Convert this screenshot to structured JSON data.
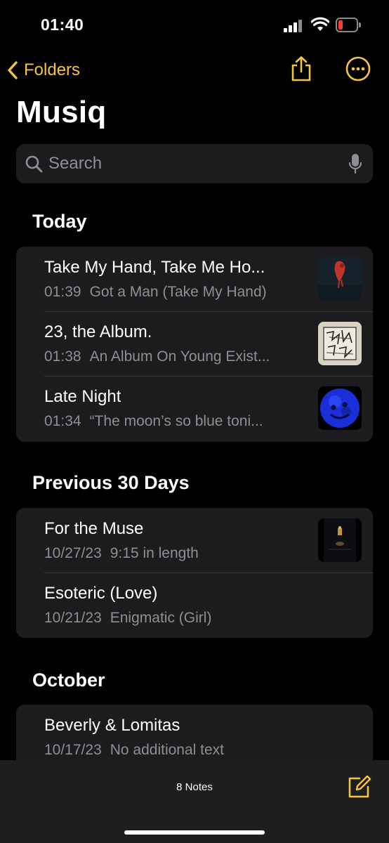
{
  "status": {
    "time": "01:40"
  },
  "nav": {
    "back_label": "Folders"
  },
  "title": "Musiq",
  "search": {
    "placeholder": "Search"
  },
  "sections": [
    {
      "title": "Today",
      "notes": [
        {
          "title": "Take My Hand, Take Me Ho...",
          "date": "01:39",
          "preview": "Got a Man (Take My Hand)",
          "thumbnail": "red-figure-artwork"
        },
        {
          "title": "23, the Album.",
          "date": "01:38",
          "preview": "An Album On Young Exist...",
          "thumbnail": "sketch-artwork"
        },
        {
          "title": "Late Night",
          "date": "01:34",
          "preview": "“The moon’s so blue toni...",
          "thumbnail": "blue-moon-artwork"
        }
      ]
    },
    {
      "title": "Previous 30 Days",
      "notes": [
        {
          "title": "For the Muse",
          "date": "10/27/23",
          "preview": "9:15 in length",
          "thumbnail": "dark-night-artwork"
        },
        {
          "title": "Esoteric (Love)",
          "date": "10/21/23",
          "preview": "Enigmatic (Girl)",
          "thumbnail": ""
        }
      ]
    },
    {
      "title": "October",
      "notes": [
        {
          "title": "Beverly & Lomitas",
          "date": "10/17/23",
          "preview": "No additional text",
          "thumbnail": ""
        }
      ]
    }
  ],
  "toolbar": {
    "count_label": "8 Notes"
  },
  "colors": {
    "accent": "#f4c542",
    "background": "#000000",
    "cell": "#1c1c1e",
    "secondary_text": "#8e8e93",
    "battery_low": "#ff3b30"
  }
}
